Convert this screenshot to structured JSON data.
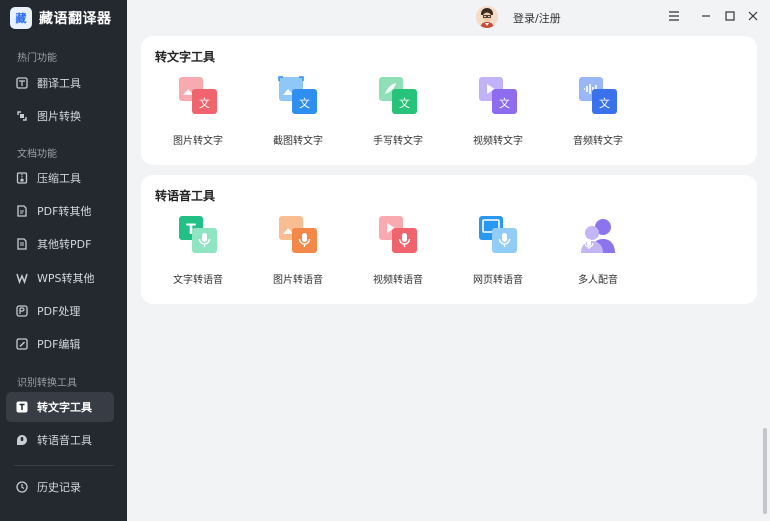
{
  "app": {
    "logo_glyph": "藏",
    "name": "藏语翻译器"
  },
  "sidebar": {
    "sections": [
      {
        "label": "热门功能"
      },
      {
        "label": "文档功能"
      },
      {
        "label": "识别转换工具"
      }
    ],
    "items": [
      {
        "label": "翻译工具",
        "icon": "translate-icon"
      },
      {
        "label": "图片转换",
        "icon": "image-convert-icon"
      },
      {
        "label": "压缩工具",
        "icon": "compress-icon"
      },
      {
        "label": "PDF转其他",
        "icon": "pdf-icon"
      },
      {
        "label": "其他转PDF",
        "icon": "to-pdf-icon"
      },
      {
        "label": "WPS转其他",
        "icon": "wps-icon"
      },
      {
        "label": "PDF处理",
        "icon": "pdf-process-icon"
      },
      {
        "label": "PDF编辑",
        "icon": "pdf-edit-icon"
      },
      {
        "label": "转文字工具",
        "icon": "text-tool-icon",
        "active": true
      },
      {
        "label": "转语音工具",
        "icon": "voice-tool-icon"
      },
      {
        "label": "历史记录",
        "icon": "history-icon"
      }
    ]
  },
  "header": {
    "login_label": "登录/注册"
  },
  "text_tools": {
    "title": "转文字工具",
    "items": [
      {
        "label": "图片转文字",
        "color": "#f0646e",
        "badge": "文"
      },
      {
        "label": "截图转文字",
        "color": "#2f8ff0",
        "badge": "文"
      },
      {
        "label": "手写转文字",
        "color": "#27c37a",
        "badge": "文"
      },
      {
        "label": "视频转文字",
        "color": "#8d6cf0",
        "badge": "文"
      },
      {
        "label": "音频转文字",
        "color": "#3a72ee",
        "badge": "文"
      }
    ]
  },
  "voice_tools": {
    "title": "转语音工具",
    "items": [
      {
        "label": "文字转语音",
        "color": "#22c086",
        "glyph": "T"
      },
      {
        "label": "图片转语音",
        "color": "#f48848"
      },
      {
        "label": "视频转语音",
        "color": "#f0646e"
      },
      {
        "label": "网页转语音",
        "color": "#2a98f0"
      },
      {
        "label": "多人配音",
        "color": "#8b74ee"
      }
    ]
  }
}
